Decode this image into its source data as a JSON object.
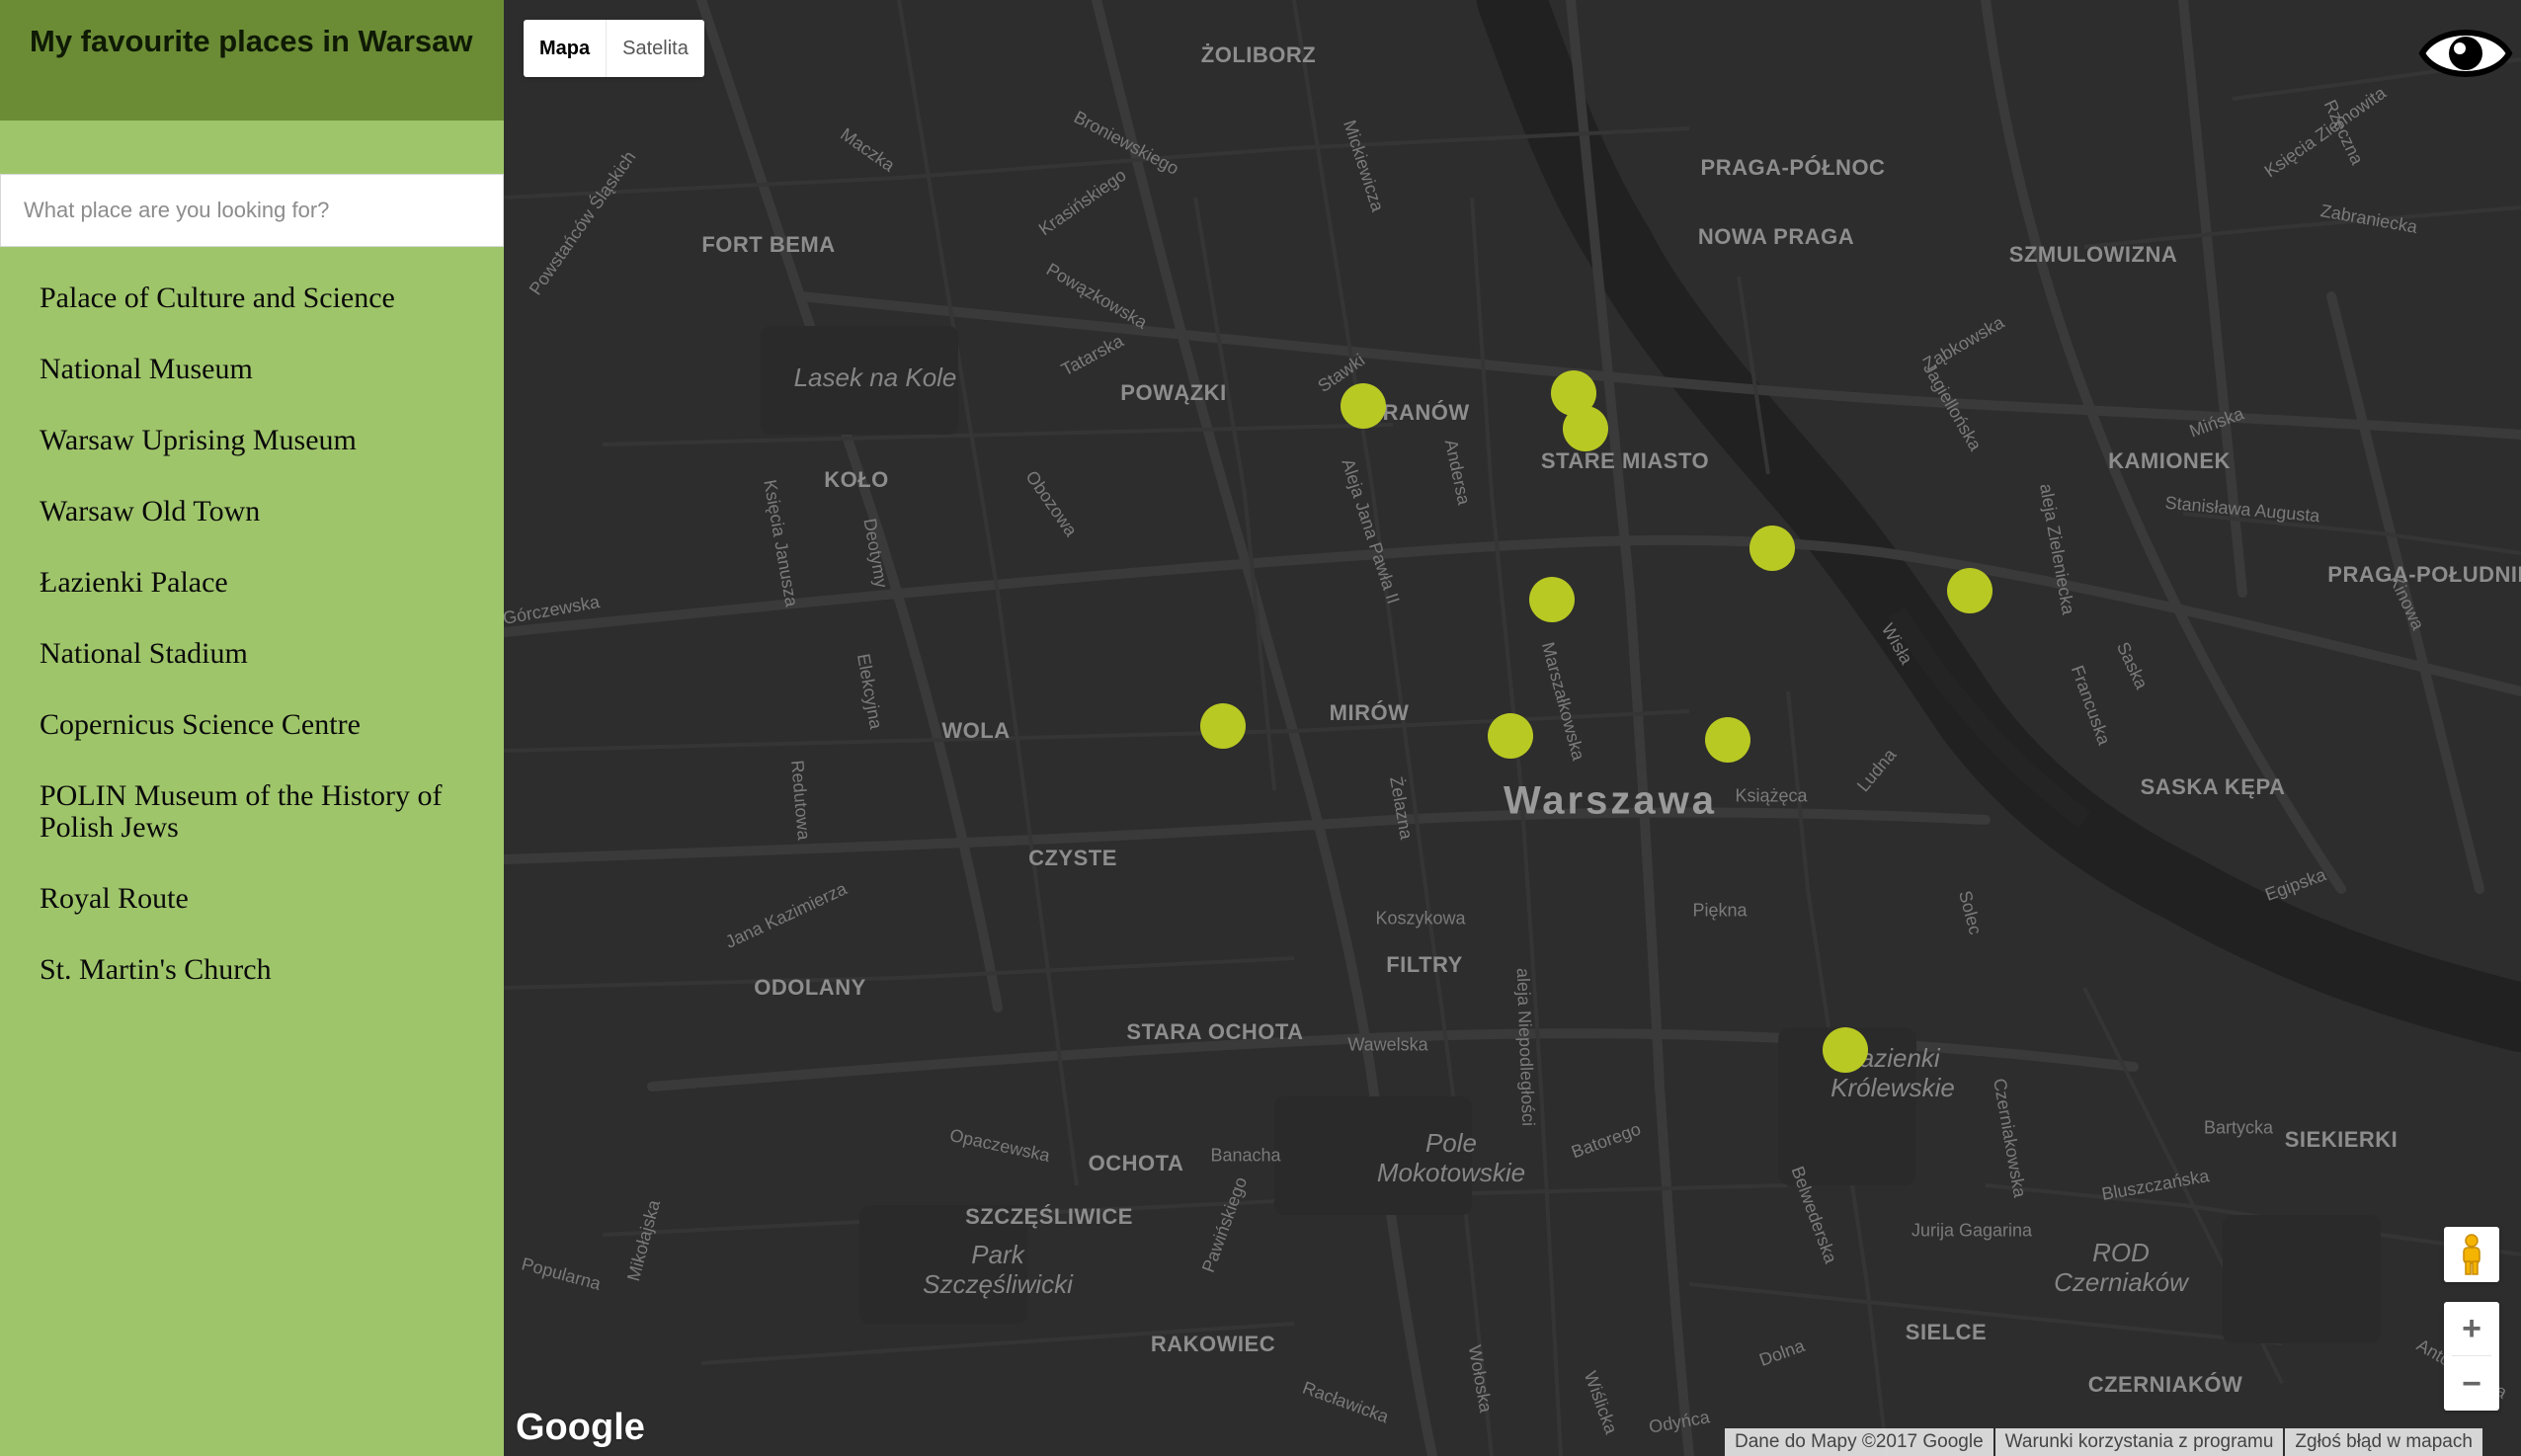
{
  "sidebar": {
    "title": "My favourite places in Warsaw",
    "search": {
      "placeholder": "What place are you looking for?",
      "value": ""
    },
    "places": [
      "Palace of Culture and Science",
      "National Museum",
      "Warsaw Uprising Museum",
      "Warsaw Old Town",
      "Łazienki Palace",
      "National Stadium",
      "Copernicus Science Centre",
      "POLIN Museum of the History of Polish Jews",
      "Royal Route",
      "St. Martin's Church"
    ]
  },
  "map": {
    "type_control": {
      "map_label": "Mapa",
      "satellite_label": "Satelita",
      "selected": "Mapa"
    },
    "zoom": {
      "in_label": "+",
      "out_label": "−"
    },
    "logo_text": "Google",
    "attribution": {
      "data": "Dane do Mapy ©2017 Google",
      "terms": "Warunki korzystania z programu",
      "report": "Zgłoś błąd w mapach"
    },
    "marker_color": "#b9c923",
    "background_color": "#2d2d2d",
    "city_label": "Warszawa",
    "district_labels": [
      "ŻOLIBORZ",
      "FORT BEMA",
      "POWĄZKI",
      "MURANÓW",
      "STARE MIASTO",
      "KOŁO",
      "PRAGA-PÓŁNOC",
      "NOWA PRAGA",
      "SZMULOWIZNA",
      "KAMIONEK",
      "PRAGA-POŁUDNIE",
      "WOLA",
      "MIRÓW",
      "CZYSTE",
      "SASKA KĘPA",
      "FILTRY",
      "ODOLANY",
      "STARA OCHOTA",
      "OCHOTA",
      "SZCZĘŚLIWICE",
      "SIEKIERKI",
      "RAKOWIEC",
      "SIELCE",
      "CZERNIAKÓW"
    ],
    "park_labels": [
      "Lasek na Kole",
      "Pole Mokotowskie",
      "Park Szczęśliwicki",
      "Łazienki Królewskie",
      "ROD Czerniaków"
    ],
    "street_labels": [
      "Broniewskiego",
      "Maczka",
      "Mickiewicza",
      "Krasińskiego",
      "Powązkowska",
      "Tatarska",
      "Stawki",
      "Andersa",
      "Aleja Jana Pawła II",
      "Obozowa",
      "Księcia Janusza",
      "Deotymy",
      "Elekcyjna",
      "Redutowa",
      "Jana Kazimierza",
      "Marszałkowska",
      "Żelazna",
      "Koszykowa",
      "Książęca",
      "Ludna",
      "Piękna",
      "Wawelska",
      "aleja Niepodległości",
      "Banacha",
      "Batorego",
      "Opaczewska",
      "Pawińskiego",
      "Racławicka",
      "Wołoska",
      "Odyńca",
      "Dolna",
      "Belwederska",
      "Jurija Gagarina",
      "Bluszczańska",
      "Bartycka",
      "Czerniakowska",
      "Solec",
      "Wisła",
      "Jagiellońska",
      "Ząbkowska",
      "Mińska",
      "Stanisława Augusta",
      "aleja Zieleniecka",
      "Francuska",
      "Saska",
      "Egipska",
      "Zabraniecka",
      "Księcia Ziemowita",
      "Rzeczna",
      "Kinowa",
      "Antoniewska",
      "Powstańców Śląskich",
      "Górczewska",
      "Popularna",
      "Mikołajska",
      "Wiślicka"
    ]
  }
}
